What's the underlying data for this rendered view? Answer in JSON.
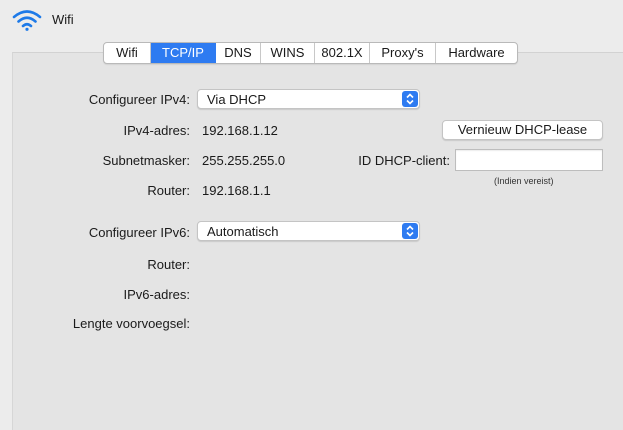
{
  "header": {
    "title": "Wifi",
    "icon": "wifi-icon"
  },
  "tabs": [
    {
      "label": "Wifi",
      "active": false
    },
    {
      "label": "TCP/IP",
      "active": true
    },
    {
      "label": "DNS",
      "active": false
    },
    {
      "label": "WINS",
      "active": false
    },
    {
      "label": "802.1X",
      "active": false
    },
    {
      "label": "Proxy's",
      "active": false
    },
    {
      "label": "Hardware",
      "active": false
    }
  ],
  "ipv4": {
    "config_label": "Configureer IPv4:",
    "config_value": "Via DHCP",
    "address_label": "IPv4-adres:",
    "address_value": "192.168.1.12",
    "subnet_label": "Subnetmasker:",
    "subnet_value": "255.255.255.0",
    "router_label": "Router:",
    "router_value": "192.168.1.1",
    "renew_button": "Vernieuw DHCP-lease",
    "client_id_label": "ID DHCP-client:",
    "client_id_value": "",
    "client_id_hint": "(Indien vereist)"
  },
  "ipv6": {
    "config_label": "Configureer IPv6:",
    "config_value": "Automatisch",
    "router_label": "Router:",
    "address_label": "IPv6-adres:",
    "prefix_label": "Lengte voorvoegsel:"
  },
  "colors": {
    "accent": "#2e7bf1",
    "background": "#ececec",
    "panel": "#e4e4e4"
  }
}
